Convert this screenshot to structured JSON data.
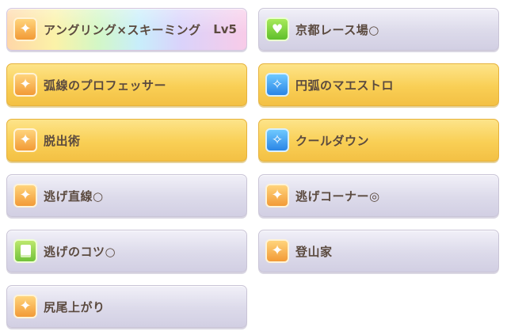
{
  "skills_left": [
    {
      "label": "アングリング×スキーミング",
      "level": "Lv5",
      "icon": "speed-icon"
    },
    {
      "label": "弧線のプロフェッサー",
      "icon": "speed-icon"
    },
    {
      "label": "脱出術",
      "icon": "speed-icon"
    },
    {
      "label": "逃げ直線○",
      "icon": "speed-icon"
    },
    {
      "label": "逃げのコツ○",
      "icon": "book-icon"
    },
    {
      "label": "尻尾上がり",
      "icon": "speed-icon"
    }
  ],
  "skills_right": [
    {
      "label": "京都レース場○",
      "icon": "heart-icon"
    },
    {
      "label": "円弧のマエストロ",
      "icon": "sparkle-icon"
    },
    {
      "label": "クールダウン",
      "icon": "sparkle-icon"
    },
    {
      "label": "逃げコーナー◎",
      "icon": "speed-icon"
    },
    {
      "label": "登山家",
      "icon": "speed-icon"
    }
  ],
  "colors": {
    "text": "#5b4a3f",
    "gold_card": "#f9cf55",
    "normal_card": "#dcdaea"
  }
}
